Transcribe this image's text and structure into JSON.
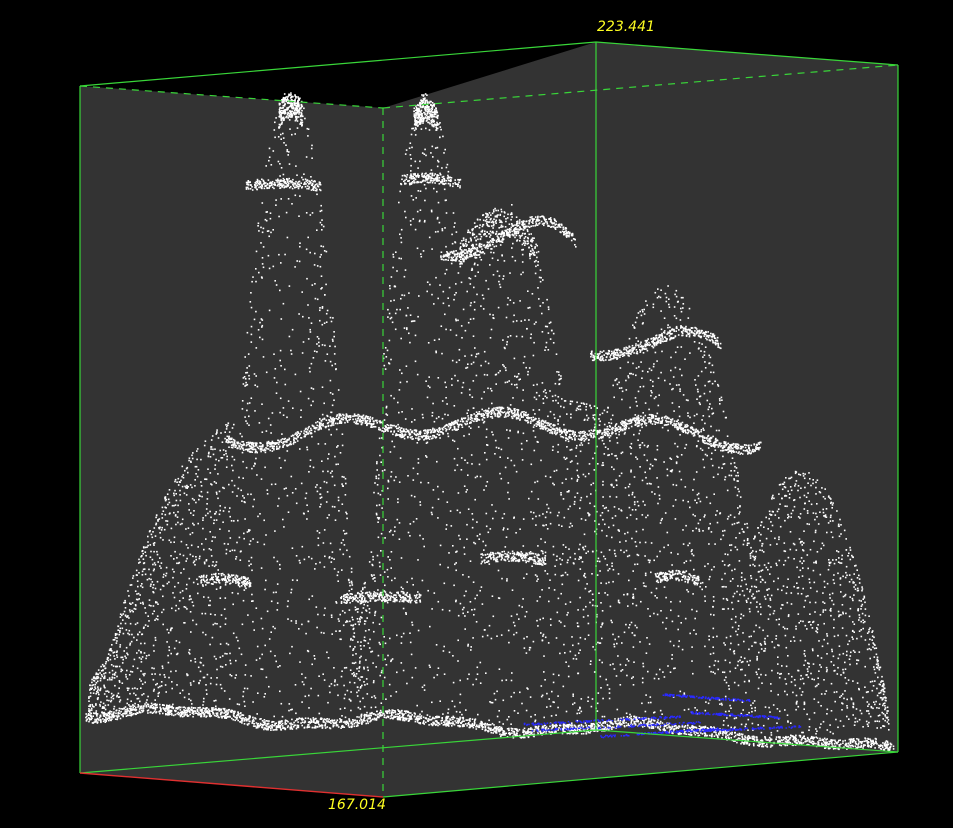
{
  "viewer": {
    "background_color": "#000000",
    "box_face_color": "#333333",
    "bbox_color": "#39d639",
    "x_axis_color": "#e03030",
    "label_color": "#ffff22",
    "point_color": "#ffffff",
    "highlight_point_color": "#2a2aff"
  },
  "labels": {
    "top_value": "223.441",
    "bottom_value": "167.014"
  },
  "point_cloud": {
    "description_icon": "point-cloud-terrain",
    "mountain_peaks_visible": 5,
    "highlighted_selection_color": "#2a2aff"
  }
}
